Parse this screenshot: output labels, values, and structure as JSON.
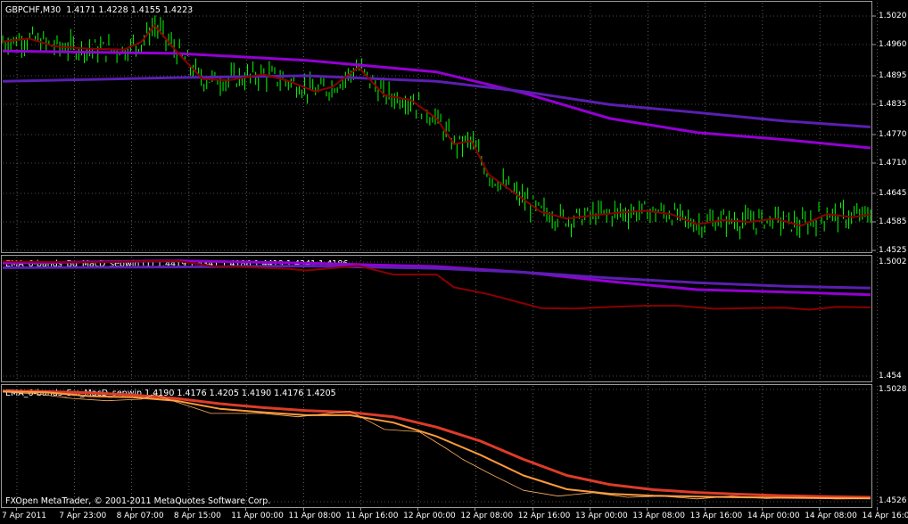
{
  "main": {
    "title": "GBPCHF,M30",
    "ohlc": "1.4171 1.4228 1.4155 1.4223",
    "price_ticks": [
      "1.5020",
      "1.4960",
      "1.4895",
      "1.4835",
      "1.4770",
      "1.4710",
      "1.4645",
      "1.4585",
      "1.4525"
    ]
  },
  "ind1": {
    "title": "EMA_6-bands_Bg_MacD_sepwin (1) 1.4419 1.4341 1.4186 1.4419 1.4341 1.4186",
    "ticks": [
      "1.5002",
      "1.454"
    ]
  },
  "ind2": {
    "title": "EMA_6-bands_Sm_MacD_sepwin 1.4190 1.4176 1.4205 1.4190 1.4176 1.4205",
    "ticks": [
      "1.5028",
      "1.4526"
    ]
  },
  "footer": {
    "copyright": "FXOpen MetaTrader, © 2001-2011 MetaQuotes Software Corp."
  },
  "time_axis": [
    "7 Apr 2011",
    "7 Apr 23:00",
    "8 Apr 07:00",
    "8 Apr 15:00",
    "11 Apr 00:00",
    "11 Apr 08:00",
    "11 Apr 16:00",
    "12 Apr 00:00",
    "12 Apr 08:00",
    "12 Apr 16:00",
    "13 Apr 00:00",
    "13 Apr 08:00",
    "13 Apr 16:00",
    "14 Apr 00:00",
    "14 Apr 08:00",
    "14 Apr 16:00"
  ],
  "colors": {
    "background": "#000000",
    "grid": "#9a9a9a",
    "candles": "#00ff00",
    "ema_fast": "#8b0000",
    "band_upper": "#9400d3",
    "band_lower": "#5a1fb0",
    "smooth_fast": "#ff9a3c",
    "smooth_slow": "#dc3c28"
  },
  "chart_data": [
    {
      "type": "line",
      "pane": "main",
      "title": "GBPCHF,M30",
      "ylim": [
        1.4505,
        1.5035
      ],
      "ema_fast": [
        [
          0,
          1.4955
        ],
        [
          0.03,
          1.4962
        ],
        [
          0.06,
          1.4945
        ],
        [
          0.1,
          1.494
        ],
        [
          0.14,
          1.4938
        ],
        [
          0.16,
          1.4955
        ],
        [
          0.175,
          1.499
        ],
        [
          0.2,
          1.4935
        ],
        [
          0.23,
          1.4875
        ],
        [
          0.26,
          1.4872
        ],
        [
          0.3,
          1.4885
        ],
        [
          0.33,
          1.487
        ],
        [
          0.36,
          1.4848
        ],
        [
          0.38,
          1.4858
        ],
        [
          0.41,
          1.49
        ],
        [
          0.44,
          1.484
        ],
        [
          0.47,
          1.483
        ],
        [
          0.5,
          1.479
        ],
        [
          0.52,
          1.4735
        ],
        [
          0.54,
          1.4742
        ],
        [
          0.56,
          1.467
        ],
        [
          0.59,
          1.463
        ],
        [
          0.62,
          1.459
        ],
        [
          0.65,
          1.4575
        ],
        [
          0.68,
          1.4582
        ],
        [
          0.71,
          1.4588
        ],
        [
          0.74,
          1.4592
        ],
        [
          0.77,
          1.4585
        ],
        [
          0.8,
          1.4563
        ],
        [
          0.83,
          1.4572
        ],
        [
          0.86,
          1.4568
        ],
        [
          0.89,
          1.4575
        ],
        [
          0.92,
          1.456
        ],
        [
          0.95,
          1.4585
        ],
        [
          0.98,
          1.4578
        ],
        [
          1,
          1.4585
        ]
      ],
      "band_upper": [
        [
          0,
          1.4935
        ],
        [
          0.2,
          1.493
        ],
        [
          0.35,
          1.4915
        ],
        [
          0.5,
          1.489
        ],
        [
          0.6,
          1.4845
        ],
        [
          0.7,
          1.479
        ],
        [
          0.8,
          1.476
        ],
        [
          0.9,
          1.4745
        ],
        [
          1,
          1.4727
        ]
      ],
      "band_lower": [
        [
          0,
          1.487
        ],
        [
          0.2,
          1.4878
        ],
        [
          0.35,
          1.4882
        ],
        [
          0.5,
          1.487
        ],
        [
          0.6,
          1.4848
        ],
        [
          0.7,
          1.482
        ],
        [
          0.8,
          1.4803
        ],
        [
          0.9,
          1.4785
        ],
        [
          1,
          1.4772
        ]
      ]
    },
    {
      "type": "line",
      "pane": "ind1",
      "ylim": [
        1.448,
        1.5005
      ],
      "fast": [
        [
          0,
          1.4992
        ],
        [
          0.1,
          1.4988
        ],
        [
          0.2,
          1.4995
        ],
        [
          0.24,
          1.4972
        ],
        [
          0.33,
          1.496
        ],
        [
          0.35,
          1.4953
        ],
        [
          0.41,
          1.4973
        ],
        [
          0.45,
          1.4935
        ],
        [
          0.5,
          1.4935
        ],
        [
          0.52,
          1.488
        ],
        [
          0.56,
          1.485
        ],
        [
          0.6,
          1.481
        ],
        [
          0.62,
          1.479
        ],
        [
          0.66,
          1.4788
        ],
        [
          0.7,
          1.4795
        ],
        [
          0.74,
          1.48
        ],
        [
          0.78,
          1.48
        ],
        [
          0.82,
          1.4787
        ],
        [
          0.86,
          1.479
        ],
        [
          0.9,
          1.4792
        ],
        [
          0.93,
          1.4783
        ],
        [
          0.96,
          1.4795
        ],
        [
          1,
          1.4793
        ]
      ],
      "band_upper": [
        [
          0,
          1.4985
        ],
        [
          0.2,
          1.4995
        ],
        [
          0.35,
          1.4985
        ],
        [
          0.5,
          1.497
        ],
        [
          0.6,
          1.4945
        ],
        [
          0.7,
          1.4905
        ],
        [
          0.8,
          1.487
        ],
        [
          0.9,
          1.486
        ],
        [
          1,
          1.4848
        ]
      ],
      "band_lower": [
        [
          0,
          1.4965
        ],
        [
          0.2,
          1.4968
        ],
        [
          0.35,
          1.4972
        ],
        [
          0.5,
          1.4962
        ],
        [
          0.6,
          1.4945
        ],
        [
          0.7,
          1.492
        ],
        [
          0.8,
          1.49
        ],
        [
          0.9,
          1.4885
        ],
        [
          1,
          1.4877
        ]
      ]
    },
    {
      "type": "line",
      "pane": "ind2",
      "ylim": [
        1.452,
        1.5032
      ],
      "thin": [
        [
          0,
          1.5013
        ],
        [
          0.04,
          1.5005
        ],
        [
          0.08,
          1.4985
        ],
        [
          0.12,
          1.4975
        ],
        [
          0.16,
          1.4982
        ],
        [
          0.175,
          1.5002
        ],
        [
          0.2,
          1.497
        ],
        [
          0.24,
          1.492
        ],
        [
          0.3,
          1.492
        ],
        [
          0.34,
          1.4905
        ],
        [
          0.4,
          1.493
        ],
        [
          0.44,
          1.485
        ],
        [
          0.48,
          1.484
        ],
        [
          0.51,
          1.477
        ],
        [
          0.53,
          1.472
        ],
        [
          0.56,
          1.466
        ],
        [
          0.6,
          1.4585
        ],
        [
          0.64,
          1.456
        ],
        [
          0.68,
          1.4575
        ],
        [
          0.72,
          1.4555
        ],
        [
          0.76,
          1.456
        ],
        [
          0.8,
          1.4548
        ],
        [
          0.84,
          1.456
        ],
        [
          0.88,
          1.455
        ],
        [
          0.92,
          1.4555
        ],
        [
          0.96,
          1.4548
        ],
        [
          1,
          1.455
        ]
      ],
      "fast": [
        [
          0,
          1.5015
        ],
        [
          0.05,
          1.5012
        ],
        [
          0.1,
          1.4995
        ],
        [
          0.15,
          1.499
        ],
        [
          0.2,
          1.4975
        ],
        [
          0.25,
          1.494
        ],
        [
          0.3,
          1.4925
        ],
        [
          0.35,
          1.4912
        ],
        [
          0.4,
          1.4912
        ],
        [
          0.45,
          1.488
        ],
        [
          0.5,
          1.482
        ],
        [
          0.55,
          1.474
        ],
        [
          0.6,
          1.465
        ],
        [
          0.65,
          1.459
        ],
        [
          0.7,
          1.457
        ],
        [
          0.75,
          1.4562
        ],
        [
          0.8,
          1.4558
        ],
        [
          0.85,
          1.4555
        ],
        [
          0.9,
          1.4553
        ],
        [
          0.95,
          1.4551
        ],
        [
          1,
          1.455
        ]
      ],
      "slow": [
        [
          0,
          1.5018
        ],
        [
          0.05,
          1.5015
        ],
        [
          0.1,
          1.501
        ],
        [
          0.15,
          1.5
        ],
        [
          0.2,
          1.4985
        ],
        [
          0.25,
          1.4962
        ],
        [
          0.3,
          1.4945
        ],
        [
          0.35,
          1.4932
        ],
        [
          0.4,
          1.4925
        ],
        [
          0.45,
          1.4905
        ],
        [
          0.5,
          1.486
        ],
        [
          0.55,
          1.48
        ],
        [
          0.6,
          1.472
        ],
        [
          0.65,
          1.465
        ],
        [
          0.7,
          1.461
        ],
        [
          0.75,
          1.4588
        ],
        [
          0.8,
          1.4576
        ],
        [
          0.85,
          1.4568
        ],
        [
          0.9,
          1.4562
        ],
        [
          0.95,
          1.4558
        ],
        [
          1,
          1.4555
        ]
      ]
    }
  ]
}
